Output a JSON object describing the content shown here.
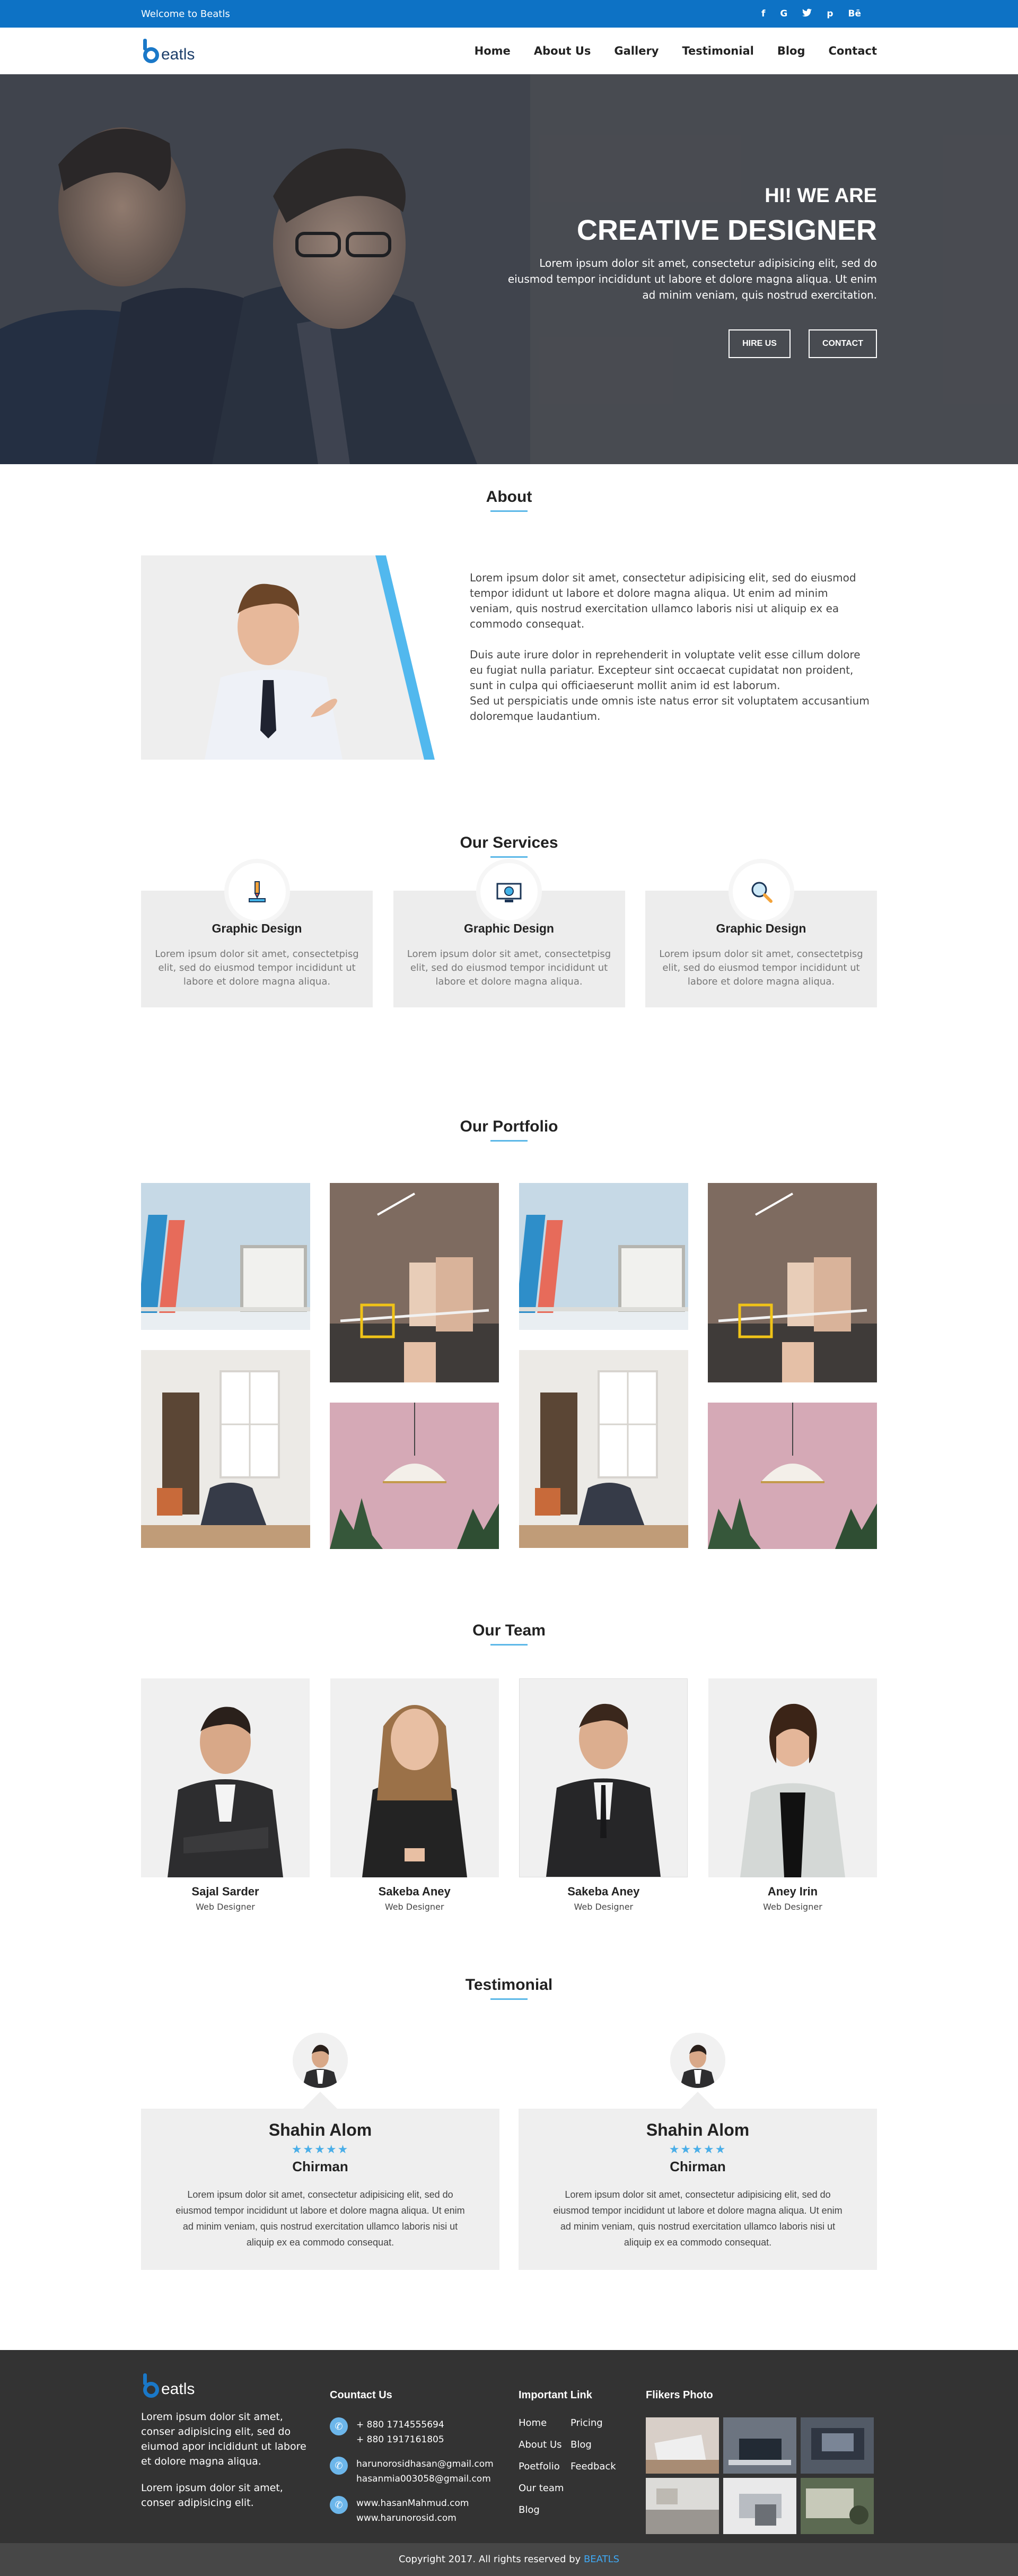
{
  "topbar": {
    "welcome": "Welcome to Beatls",
    "social_icons": [
      "facebook-icon",
      "google-icon",
      "twitter-icon",
      "pinterest-icon",
      "behance-icon"
    ],
    "social_glyphs": [
      "f",
      "G",
      "t",
      "p",
      "Bē"
    ]
  },
  "brand": {
    "logo_text": "eatls",
    "accent": "#0d72c5"
  },
  "nav": {
    "items": [
      "Home",
      "About Us",
      "Gallery",
      "Testimonial",
      "Blog",
      "Contact"
    ]
  },
  "hero": {
    "subtitle": "HI! WE ARE",
    "title": "CREATIVE DESIGNER",
    "text": "Lorem ipsum dolor sit amet, consectetur adipisicing elit, sed do eiusmod tempor incididunt ut labore et dolore magna aliqua. Ut enim ad minim veniam, quis nostrud exercitation.",
    "btn_hire": "HIRE US",
    "btn_contact": "CONTACT"
  },
  "about": {
    "title": "About",
    "para1": "Lorem ipsum dolor sit amet, consectetur adipisicing elit, sed do eiusmod tempor ididunt ut labore et dolore magna aliqua. Ut enim ad minim veniam, quis nostrud exercitation ullamco laboris nisi ut aliquip ex ea commodo consequat.",
    "para2": "Duis aute irure dolor in reprehenderit in voluptate velit esse cillum dolore eu fugiat nulla pariatur. Excepteur sint occaecat cupidatat non proident, sunt in culpa qui officiaeserunt mollit anim id est laborum.",
    "para3": "Sed ut perspiciatis unde omnis iste natus error sit voluptatem accusantium doloremque laudantium."
  },
  "services": {
    "title": "Our Services",
    "items": [
      {
        "title": "Graphic Design",
        "text": "Lorem ipsum dolor sit amet, consectetpisg elit, sed do eiusmod tempor incididunt ut labore et dolore magna aliqua.",
        "icon": "pen-tool-icon"
      },
      {
        "title": "Graphic Design",
        "text": "Lorem ipsum dolor sit amet, consectetpisg elit, sed do eiusmod tempor incididunt ut labore et dolore magna aliqua.",
        "icon": "monitor-icon"
      },
      {
        "title": "Graphic Design",
        "text": "Lorem ipsum dolor sit amet, consectetpisg elit, sed do eiusmod tempor incididunt ut labore et dolore magna aliqua.",
        "icon": "search-icon"
      }
    ]
  },
  "portfolio": {
    "title": "Our Portfolio"
  },
  "team": {
    "title": "Our Team",
    "members": [
      {
        "name": "Sajal Sarder",
        "role": "Web Designer"
      },
      {
        "name": "Sakeba Aney",
        "role": "Web Designer"
      },
      {
        "name": "Sakeba Aney",
        "role": "Web Designer"
      },
      {
        "name": "Aney Irin",
        "role": "Web Designer"
      }
    ]
  },
  "testimonial": {
    "title": "Testimonial",
    "items": [
      {
        "name": "Shahin Alom",
        "role": "Chirman",
        "stars": "★★★★★",
        "text": "Lorem ipsum dolor sit amet, consectetur adipisicing elit, sed do eiusmod tempor incididunt ut labore et dolore magna aliqua. Ut enim ad minim veniam, quis nostrud exercitation ullamco laboris nisi ut aliquip ex ea commodo consequat."
      },
      {
        "name": "Shahin Alom",
        "role": "Chirman",
        "stars": "★★★★★",
        "text": "Lorem ipsum dolor sit amet, consectetur adipisicing elit, sed do eiusmod tempor incididunt ut labore et dolore magna aliqua. Ut enim ad minim veniam, quis nostrud exercitation ullamco laboris nisi ut aliquip ex ea commodo consequat."
      }
    ]
  },
  "footer": {
    "logo_text": "eatls",
    "about_text1": "Lorem ipsum dolor sit amet, conser adipisicing elit, sed do eiumod apor incididunt ut labore et dolore magna aliqua.",
    "about_text2": "Lorem ipsum dolor sit amet, conser adipisicing elit.",
    "contact_title": "Countact Us",
    "phone1": "+ 880 1714555694",
    "phone2": "+ 880 1917161805",
    "email1": "harunorosidhasan@gmail.com",
    "email2": "hasanmia003058@gmail.com",
    "web1": "www.hasanMahmud.com",
    "web2": "www.harunorosid.com",
    "links_title": "Important Link",
    "links": [
      "Home",
      "Pricing",
      "About Us",
      "Blog",
      "Poetfolio",
      "Feedback",
      "Our team",
      "",
      "Blog",
      ""
    ],
    "photos_title": "Flikers Photo",
    "copyright": "Copyright 2017. All rights reserved by",
    "copyright_brand": "BEATLS"
  }
}
